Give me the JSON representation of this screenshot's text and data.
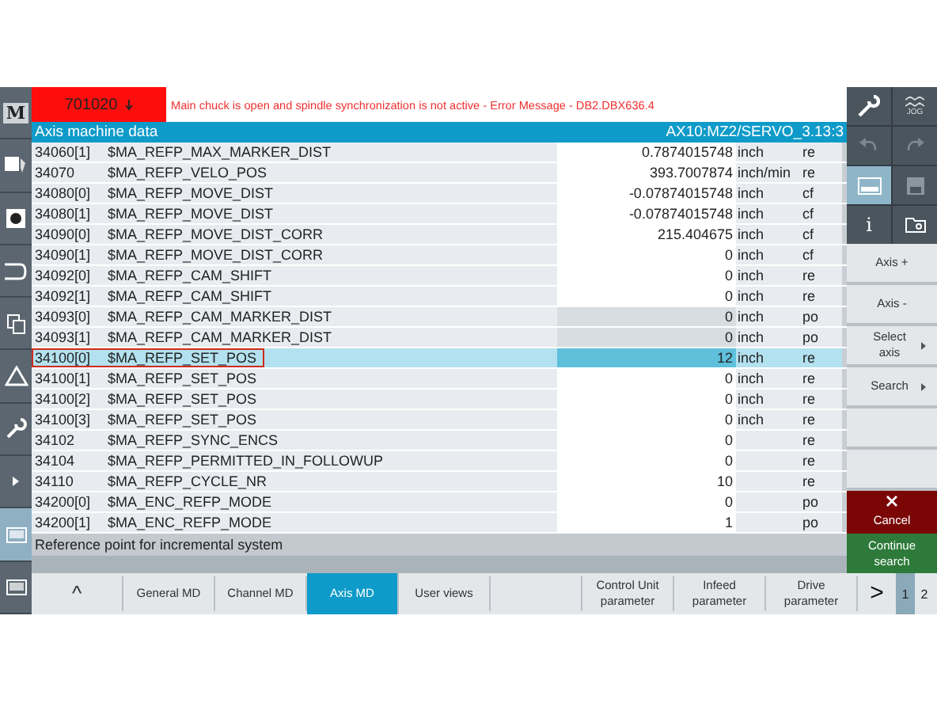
{
  "alarm": {
    "code": "701020",
    "message": "Main chuck is open and spindle synchronization is not active - Error Message -  DB2.DBX636.4"
  },
  "header": {
    "title": "Axis machine data",
    "axis": "AX10:MZ2/SERVO_3.13:3"
  },
  "rows": [
    {
      "number": "34060[1]",
      "name": "$MA_REFP_MAX_MARKER_DIST",
      "value": "0.7874015748",
      "unit": "inch",
      "attr": "re",
      "editable": true,
      "selected": false
    },
    {
      "number": "34070",
      "name": "$MA_REFP_VELO_POS",
      "value": "393.7007874",
      "unit": "inch/min",
      "attr": "re",
      "editable": true,
      "selected": false
    },
    {
      "number": "34080[0]",
      "name": "$MA_REFP_MOVE_DIST",
      "value": "-0.07874015748",
      "unit": "inch",
      "attr": "cf",
      "editable": true,
      "selected": false
    },
    {
      "number": "34080[1]",
      "name": "$MA_REFP_MOVE_DIST",
      "value": "-0.07874015748",
      "unit": "inch",
      "attr": "cf",
      "editable": true,
      "selected": false
    },
    {
      "number": "34090[0]",
      "name": "$MA_REFP_MOVE_DIST_CORR",
      "value": "215.404675",
      "unit": "inch",
      "attr": "cf",
      "editable": true,
      "selected": false
    },
    {
      "number": "34090[1]",
      "name": "$MA_REFP_MOVE_DIST_CORR",
      "value": "0",
      "unit": "inch",
      "attr": "cf",
      "editable": true,
      "selected": false
    },
    {
      "number": "34092[0]",
      "name": "$MA_REFP_CAM_SHIFT",
      "value": "0",
      "unit": "inch",
      "attr": "re",
      "editable": true,
      "selected": false
    },
    {
      "number": "34092[1]",
      "name": "$MA_REFP_CAM_SHIFT",
      "value": "0",
      "unit": "inch",
      "attr": "re",
      "editable": true,
      "selected": false
    },
    {
      "number": "34093[0]",
      "name": "$MA_REFP_CAM_MARKER_DIST",
      "value": "0",
      "unit": "inch",
      "attr": "po",
      "editable": false,
      "selected": false
    },
    {
      "number": "34093[1]",
      "name": "$MA_REFP_CAM_MARKER_DIST",
      "value": "0",
      "unit": "inch",
      "attr": "po",
      "editable": false,
      "selected": false
    },
    {
      "number": "34100[0]",
      "name": "$MA_REFP_SET_POS",
      "value": "12",
      "unit": "inch",
      "attr": "re",
      "editable": true,
      "selected": true
    },
    {
      "number": "34100[1]",
      "name": "$MA_REFP_SET_POS",
      "value": "0",
      "unit": "inch",
      "attr": "re",
      "editable": true,
      "selected": false
    },
    {
      "number": "34100[2]",
      "name": "$MA_REFP_SET_POS",
      "value": "0",
      "unit": "inch",
      "attr": "re",
      "editable": true,
      "selected": false
    },
    {
      "number": "34100[3]",
      "name": "$MA_REFP_SET_POS",
      "value": "0",
      "unit": "inch",
      "attr": "re",
      "editable": true,
      "selected": false
    },
    {
      "number": "34102",
      "name": "$MA_REFP_SYNC_ENCS",
      "value": "0",
      "attr": "re",
      "editable": true,
      "selected": false
    },
    {
      "number": "34104",
      "name": "$MA_REFP_PERMITTED_IN_FOLLOWUP",
      "value": "0",
      "attr": "re",
      "editable": true,
      "selected": false
    },
    {
      "number": "34110",
      "name": "$MA_REFP_CYCLE_NR",
      "value": "10",
      "attr": "re",
      "editable": true,
      "selected": false
    },
    {
      "number": "34200[0]",
      "name": "$MA_ENC_REFP_MODE",
      "value": "0",
      "attr": "po",
      "editable": true,
      "selected": false
    },
    {
      "number": "34200[1]",
      "name": "$MA_ENC_REFP_MODE",
      "value": "1",
      "attr": "po",
      "editable": true,
      "selected": false
    }
  ],
  "status_bar": "Reference point for incremental system",
  "left_icons": [
    {
      "kind": "letter",
      "label": "M",
      "selected": false
    },
    {
      "kind": "edit",
      "selected": false
    },
    {
      "kind": "target",
      "selected": false
    },
    {
      "kind": "bracket",
      "selected": false
    },
    {
      "kind": "copy",
      "selected": false
    },
    {
      "kind": "alarm",
      "selected": false
    },
    {
      "kind": "wrench",
      "selected": false
    },
    {
      "kind": "arrow",
      "selected": false
    },
    {
      "kind": "screen",
      "selected": true
    },
    {
      "kind": "screen",
      "selected": false
    }
  ],
  "right_icons": [
    {
      "kind": "wrench",
      "selected": false
    },
    {
      "kind": "jog",
      "label": "JOG",
      "selected": false
    },
    {
      "kind": "undo",
      "selected": false
    },
    {
      "kind": "redo",
      "selected": false
    },
    {
      "kind": "screen",
      "selected": true
    },
    {
      "kind": "save",
      "selected": false
    },
    {
      "kind": "info",
      "label": "i",
      "selected": false
    },
    {
      "kind": "folder",
      "selected": false
    }
  ],
  "vertical_softkeys": [
    {
      "kind": "normal",
      "label": "Axis +"
    },
    {
      "kind": "normal",
      "label": "Axis -"
    },
    {
      "kind": "menu",
      "label": "Select axis"
    },
    {
      "kind": "menu",
      "label": "Search"
    },
    {
      "kind": "empty"
    },
    {
      "kind": "empty"
    },
    {
      "kind": "cancel",
      "label": "Cancel"
    },
    {
      "kind": "continue",
      "label": "Continue search"
    }
  ],
  "bottom_softkeys": [
    {
      "label": "^",
      "selected": false
    },
    {
      "label": "General MD",
      "selected": false
    },
    {
      "label": "Channel MD",
      "selected": false
    },
    {
      "label": "Axis MD",
      "selected": true
    },
    {
      "label": "User views",
      "selected": false
    }
  ],
  "bottom_softkeys_right": [
    {
      "label": "Control Unit parameter",
      "selected": false
    },
    {
      "label": "Infeed parameter",
      "selected": false
    },
    {
      "label": "Drive parameter",
      "selected": false
    },
    {
      "label": ">",
      "selected": false
    }
  ],
  "pages": [
    {
      "label": "1",
      "selected": true
    },
    {
      "label": "2",
      "selected": false
    }
  ]
}
